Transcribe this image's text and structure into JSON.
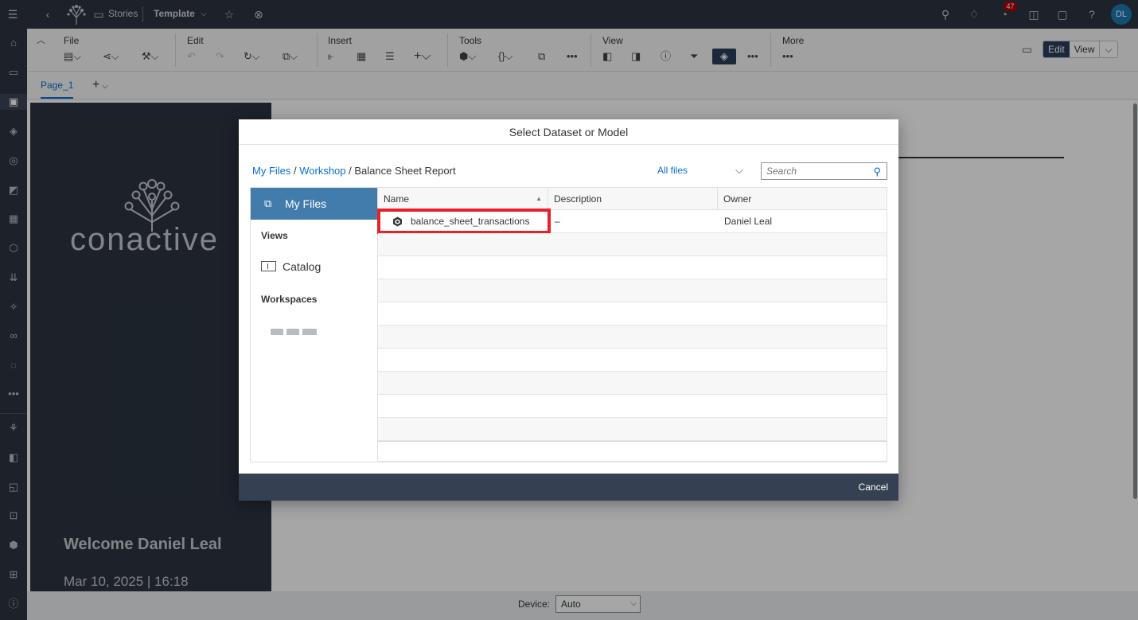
{
  "shell": {
    "app_name": "Stories",
    "story_title": "Template",
    "notification_count": "47",
    "avatar_initials": "DL",
    "icons": [
      "menu-icon",
      "back-icon",
      "tree-logo-icon",
      "stories-icon",
      "chevron-down-icon",
      "favorite-star-icon",
      "close-circle-icon",
      "search-icon",
      "lightbulb-icon",
      "bell-icon",
      "chat-icon",
      "feedback-icon",
      "help-icon"
    ]
  },
  "toolbar": {
    "groups": {
      "file": "File",
      "edit": "Edit",
      "insert": "Insert",
      "tools": "Tools",
      "view": "View",
      "more": "More"
    },
    "mode_edit": "Edit",
    "mode_view": "View"
  },
  "pages": {
    "active_tab": "Page_1"
  },
  "canvas": {
    "logo_text": "conactive",
    "welcome": "Welcome Daniel Leal",
    "datetime": "Mar 10, 2025 | 16:18"
  },
  "bottom": {
    "device_label": "Device:",
    "device_value": "Auto"
  },
  "dialog": {
    "title": "Select Dataset or Model",
    "breadcrumb": {
      "root": "My Files",
      "sep1": " / ",
      "folder": "Workshop",
      "sep2": " / ",
      "current": "Balance Sheet Report"
    },
    "filter_value": "All files",
    "search_placeholder": "Search",
    "side": {
      "my_files": "My Files",
      "views_header": "Views",
      "catalog": "Catalog",
      "workspaces_header": "Workspaces"
    },
    "table": {
      "columns": [
        "Name",
        "Description",
        "Owner"
      ],
      "rows": [
        {
          "name": "balance_sheet_transactions",
          "description": "–",
          "owner": "Daniel Leal"
        }
      ]
    },
    "cancel": "Cancel"
  },
  "colors": {
    "shell_bg": "#2b3441",
    "accent_blue": "#0a6ed1",
    "selected_side": "#427cac",
    "highlight_red": "#e8202a",
    "footer_bg": "#354152"
  }
}
